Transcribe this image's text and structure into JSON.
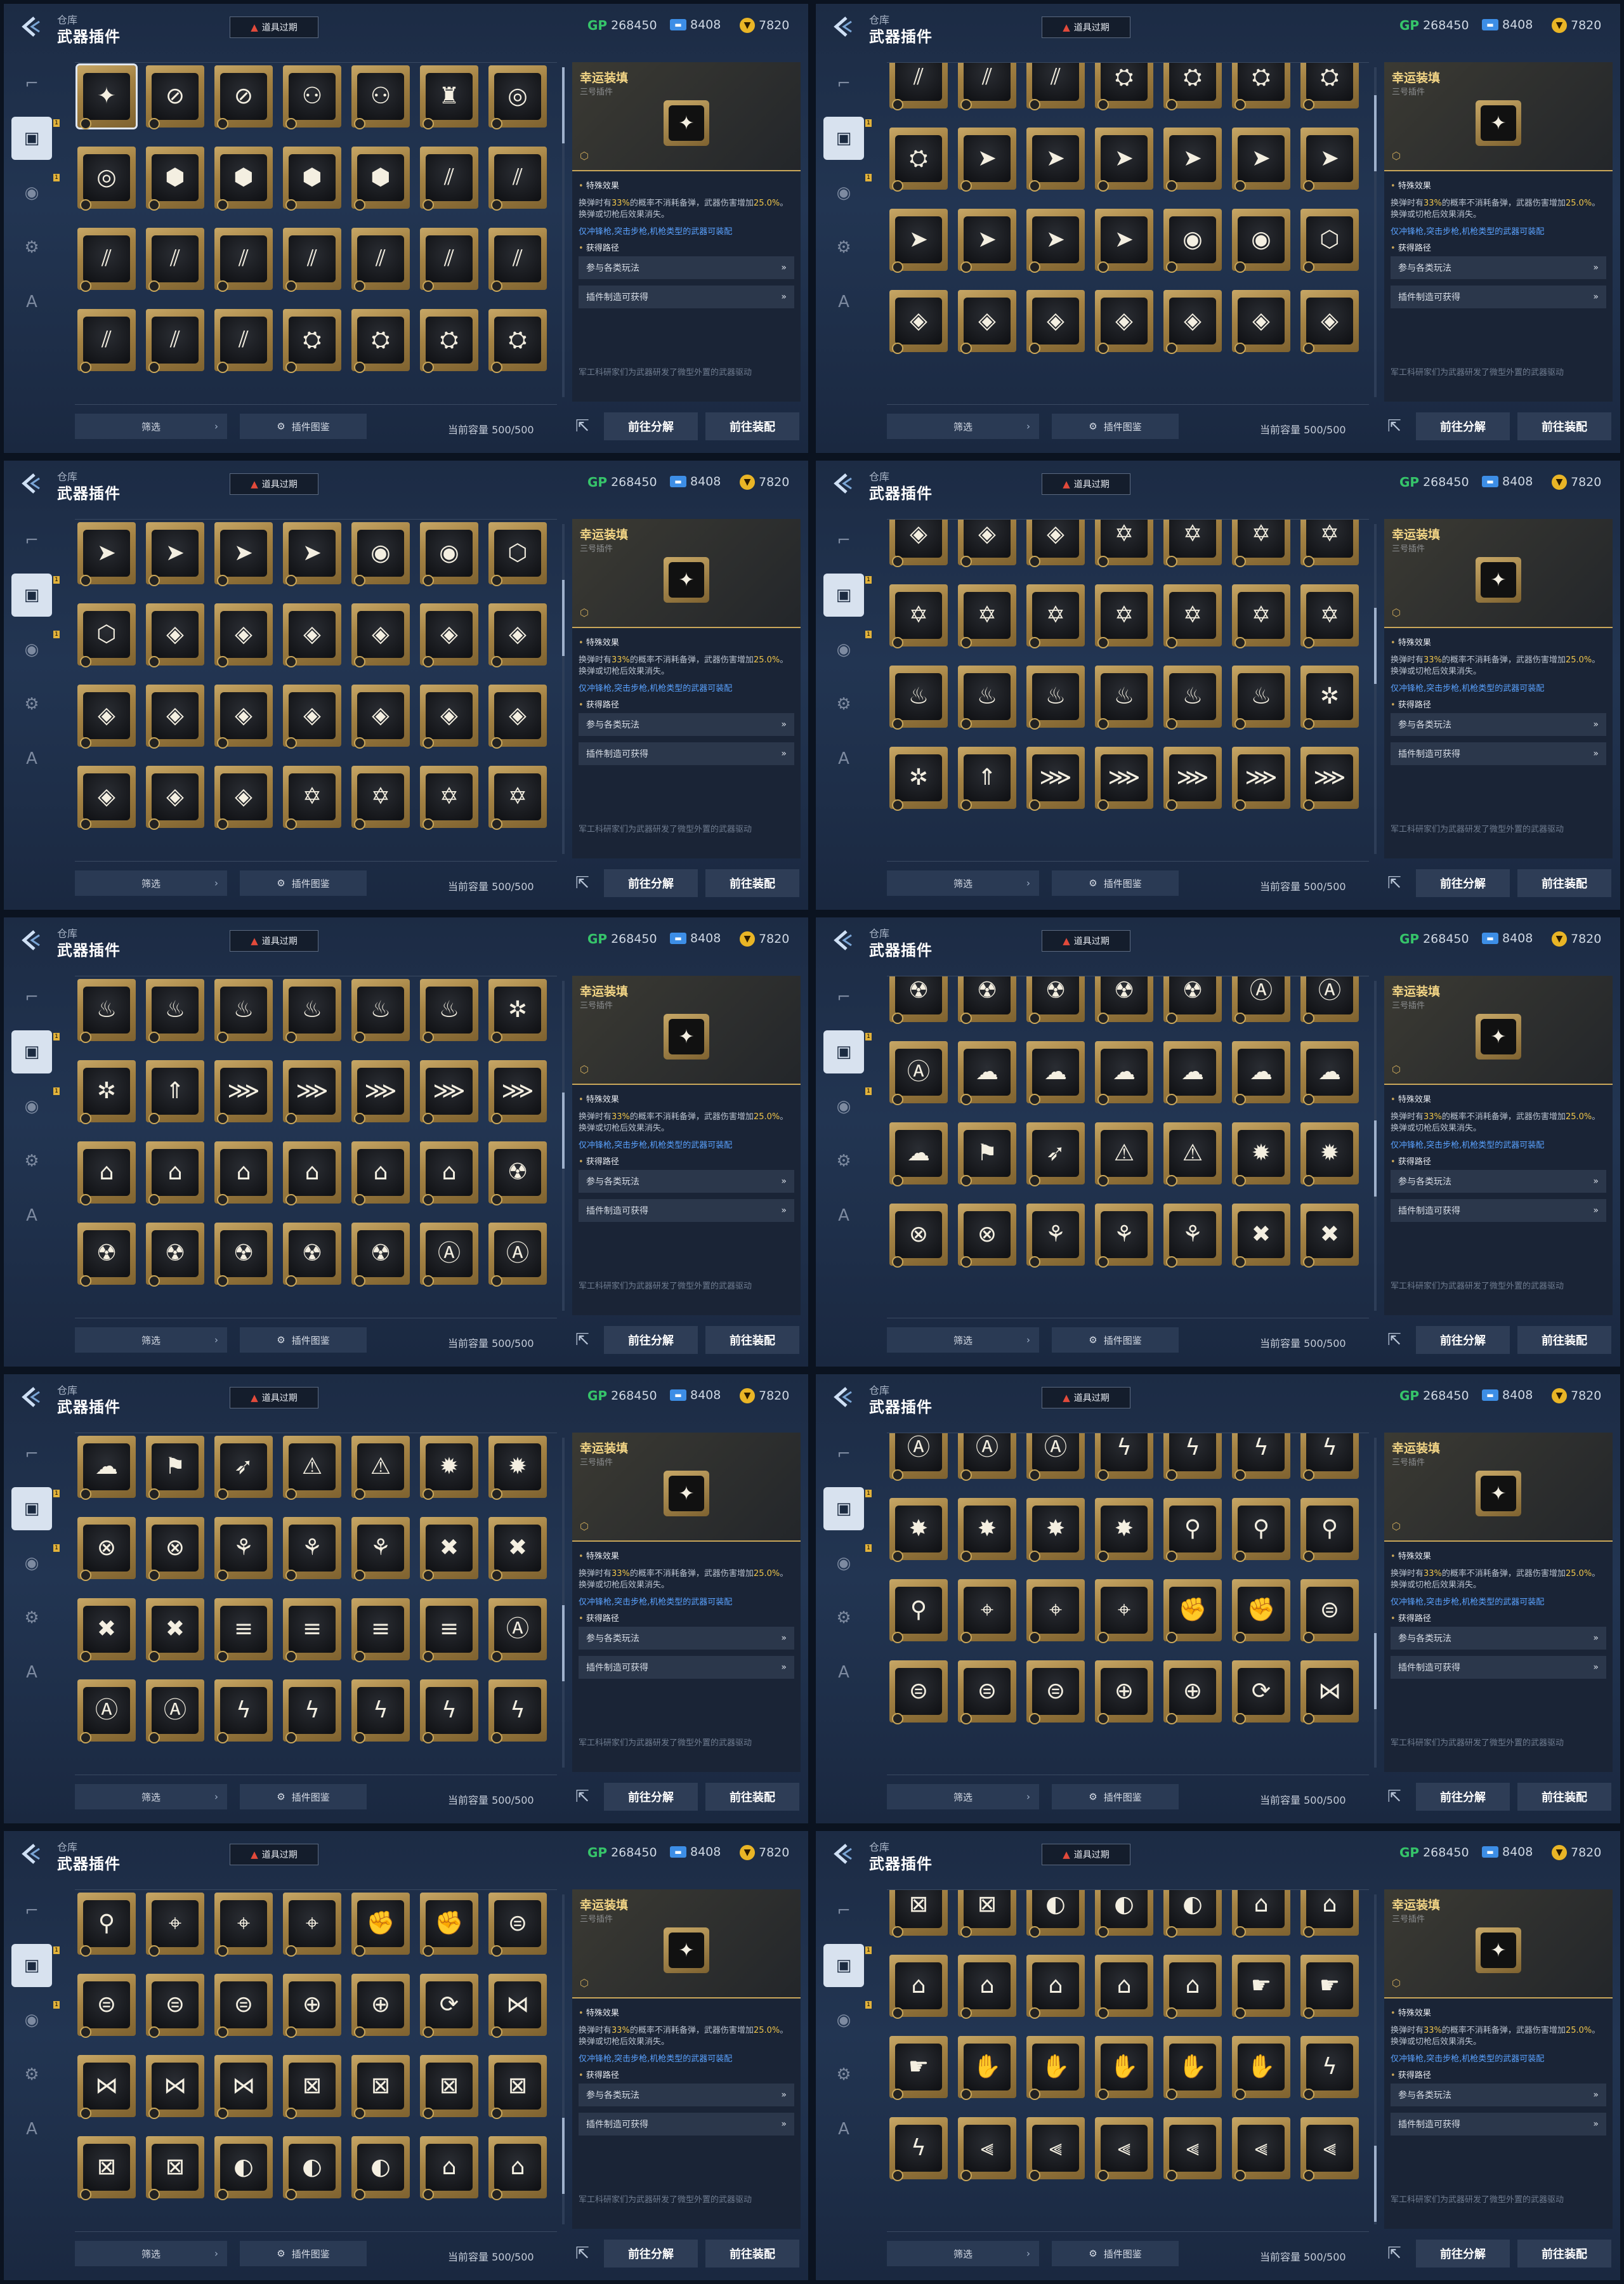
{
  "window": {
    "crumb": "仓库",
    "title": "武器插件",
    "expire_label": "道具过期",
    "expire_icon": "warning-triangle-icon"
  },
  "currency": {
    "gp_label": "GP",
    "gp_value": "268450",
    "ticket_value": "8408",
    "coin_value": "7820"
  },
  "sidebar": {
    "tabs": [
      {
        "icon": "pistol-icon",
        "glyph": "⌐"
      },
      {
        "icon": "chip-icon",
        "glyph": "▣"
      },
      {
        "icon": "grenade-icon",
        "glyph": "◉"
      },
      {
        "icon": "vehicle-icon",
        "glyph": "⚙"
      },
      {
        "icon": "emblem-icon",
        "glyph": "A"
      }
    ],
    "badge": "1"
  },
  "detail": {
    "name": "幸运装填",
    "subtitle": "三号插件",
    "special_header": "特殊效果",
    "effect_pre": "换弹时有",
    "effect_pct": "33%",
    "effect_mid": "的概率不消耗备弹，武器伤害增加",
    "effect_val": "25.0%",
    "effect_post": "。换弹或切枪后效果消失。",
    "limit": "仅冲锋枪,突击步枪,机枪类型的武器可装配",
    "source_header": "获得路径",
    "link1": "参与各类玩法",
    "link2": "插件制造可获得",
    "chevron": "»",
    "flavor": "军工科研家们为武器研发了微型外置的武器驱动"
  },
  "bottom": {
    "filter": "筛选",
    "atlas": "插件图鉴",
    "capacity": "当前容量 500/500",
    "btn_decompose": "前往分解",
    "btn_equip": "前往装配"
  },
  "panels": [
    {
      "scroll": 0,
      "rows": [
        [
          "✦",
          "⊘",
          "⊘",
          "⚇",
          "⚇",
          "♜",
          "◎"
        ],
        [
          "◎",
          "⬢",
          "⬢",
          "⬢",
          "⬢",
          "⫽",
          "⫽"
        ],
        [
          "⫽",
          "⫽",
          "⫽",
          "⫽",
          "⫽",
          "⫽",
          "⫽"
        ],
        [
          "⫽",
          "⫽",
          "⫽",
          "⛭",
          "⛭",
          "⛭",
          "⛭"
        ]
      ]
    },
    {
      "scroll": 1,
      "rows": [
        [
          "⫽",
          "⫽",
          "⫽",
          "⛭",
          "⛭",
          "⛭",
          "⛭"
        ],
        [
          "⛭",
          "➤",
          "➤",
          "➤",
          "➤",
          "➤",
          "➤"
        ],
        [
          "➤",
          "➤",
          "➤",
          "➤",
          "◉",
          "◉",
          "⬡"
        ],
        [
          "◈",
          "◈",
          "◈",
          "◈",
          "◈",
          "◈",
          "◈"
        ]
      ]
    },
    {
      "scroll": 2,
      "rows": [
        [
          "➤",
          "➤",
          "➤",
          "➤",
          "◉",
          "◉",
          "⬡"
        ],
        [
          "⬡",
          "◈",
          "◈",
          "◈",
          "◈",
          "◈",
          "◈"
        ],
        [
          "◈",
          "◈",
          "◈",
          "◈",
          "◈",
          "◈",
          "◈"
        ],
        [
          "◈",
          "◈",
          "◈",
          "✡",
          "✡",
          "✡",
          "✡"
        ]
      ]
    },
    {
      "scroll": 3,
      "rows": [
        [
          "◈",
          "◈",
          "◈",
          "✡",
          "✡",
          "✡",
          "✡"
        ],
        [
          "✡",
          "✡",
          "✡",
          "✡",
          "✡",
          "✡",
          "✡"
        ],
        [
          "♨",
          "♨",
          "♨",
          "♨",
          "♨",
          "♨",
          "✲"
        ],
        [
          "✲",
          "⇑",
          "⋙",
          "⋙",
          "⋙",
          "⋙",
          "⋙"
        ]
      ]
    },
    {
      "scroll": 4,
      "rows": [
        [
          "♨",
          "♨",
          "♨",
          "♨",
          "♨",
          "♨",
          "✲"
        ],
        [
          "✲",
          "⇑",
          "⋙",
          "⋙",
          "⋙",
          "⋙",
          "⋙"
        ],
        [
          "⌂",
          "⌂",
          "⌂",
          "⌂",
          "⌂",
          "⌂",
          "☢"
        ],
        [
          "☢",
          "☢",
          "☢",
          "☢",
          "☢",
          "Ⓐ",
          "Ⓐ"
        ]
      ]
    },
    {
      "scroll": 5,
      "rows": [
        [
          "☢",
          "☢",
          "☢",
          "☢",
          "☢",
          "Ⓐ",
          "Ⓐ"
        ],
        [
          "Ⓐ",
          "☁",
          "☁",
          "☁",
          "☁",
          "☁",
          "☁"
        ],
        [
          "☁",
          "⚑",
          "➶",
          "⚠",
          "⚠",
          "✹",
          "✹"
        ],
        [
          "⊗",
          "⊗",
          "⚘",
          "⚘",
          "⚘",
          "✖",
          "✖"
        ]
      ]
    },
    {
      "scroll": 6,
      "rows": [
        [
          "☁",
          "⚑",
          "➶",
          "⚠",
          "⚠",
          "✹",
          "✹"
        ],
        [
          "⊗",
          "⊗",
          "⚘",
          "⚘",
          "⚘",
          "✖",
          "✖"
        ],
        [
          "✖",
          "✖",
          "≡",
          "≡",
          "≡",
          "≡",
          "Ⓐ"
        ],
        [
          "Ⓐ",
          "Ⓐ",
          "ϟ",
          "ϟ",
          "ϟ",
          "ϟ",
          "ϟ"
        ]
      ]
    },
    {
      "scroll": 7,
      "rows": [
        [
          "Ⓐ",
          "Ⓐ",
          "Ⓐ",
          "ϟ",
          "ϟ",
          "ϟ",
          "ϟ"
        ],
        [
          "✸",
          "✸",
          "✸",
          "✸",
          "⚲",
          "⚲",
          "⚲"
        ],
        [
          "⚲",
          "⌖",
          "⌖",
          "⌖",
          "✊",
          "✊",
          "⊜"
        ],
        [
          "⊜",
          "⊜",
          "⊜",
          "⊕",
          "⊕",
          "⟳",
          "⋈"
        ]
      ]
    },
    {
      "scroll": 8,
      "rows": [
        [
          "⚲",
          "⌖",
          "⌖",
          "⌖",
          "✊",
          "✊",
          "⊜"
        ],
        [
          "⊜",
          "⊜",
          "⊜",
          "⊕",
          "⊕",
          "⟳",
          "⋈"
        ],
        [
          "⋈",
          "⋈",
          "⋈",
          "⊠",
          "⊠",
          "⊠",
          "⊠"
        ],
        [
          "⊠",
          "⊠",
          "◐",
          "◐",
          "◐",
          "⌂",
          "⌂"
        ]
      ]
    },
    {
      "scroll": 9,
      "rows": [
        [
          "⊠",
          "⊠",
          "◐",
          "◐",
          "◐",
          "⌂",
          "⌂"
        ],
        [
          "⌂",
          "⌂",
          "⌂",
          "⌂",
          "⌂",
          "☛",
          "☛"
        ],
        [
          "☛",
          "✋",
          "✋",
          "✋",
          "✋",
          "✋",
          "ϟ"
        ],
        [
          "ϟ",
          "⫷",
          "⫷",
          "⫷",
          "⫷",
          "⫷",
          "⫷"
        ]
      ]
    }
  ]
}
